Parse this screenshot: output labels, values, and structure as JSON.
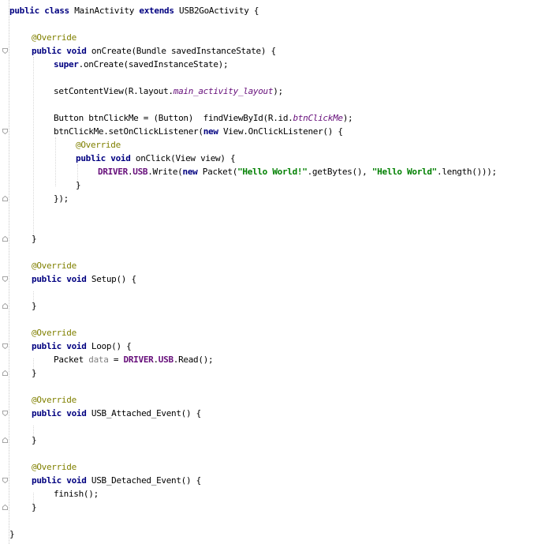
{
  "editor": {
    "lines": [
      {
        "indent": 0,
        "fold": "none",
        "tokens": [
          {
            "t": "public class ",
            "c": "kw"
          },
          {
            "t": "MainActivity ",
            "c": ""
          },
          {
            "t": "extends ",
            "c": "kw"
          },
          {
            "t": "USB2GoActivity {",
            "c": ""
          }
        ]
      },
      {
        "indent": 0,
        "fold": "none",
        "tokens": []
      },
      {
        "indent": 1,
        "fold": "none",
        "tokens": [
          {
            "t": "@Override",
            "c": "ann"
          }
        ]
      },
      {
        "indent": 1,
        "fold": "open",
        "tokens": [
          {
            "t": "public void ",
            "c": "kw"
          },
          {
            "t": "onCreate(Bundle savedInstanceState) {",
            "c": ""
          }
        ]
      },
      {
        "indent": 2,
        "fold": "none",
        "tokens": [
          {
            "t": "super",
            "c": "kw"
          },
          {
            "t": ".onCreate(savedInstanceState);",
            "c": ""
          }
        ]
      },
      {
        "indent": 0,
        "fold": "none",
        "tokens": []
      },
      {
        "indent": 2,
        "fold": "none",
        "tokens": [
          {
            "t": "setContentView(R.layout.",
            "c": ""
          },
          {
            "t": "main_activity_layout",
            "c": "ital"
          },
          {
            "t": ");",
            "c": ""
          }
        ]
      },
      {
        "indent": 0,
        "fold": "none",
        "tokens": []
      },
      {
        "indent": 2,
        "fold": "none",
        "tokens": [
          {
            "t": "Button btnClickMe = (Button)  findViewById(R.id.",
            "c": ""
          },
          {
            "t": "btnClickMe",
            "c": "ital"
          },
          {
            "t": ");",
            "c": ""
          }
        ]
      },
      {
        "indent": 2,
        "fold": "open",
        "tokens": [
          {
            "t": "btnClickMe.setOnClickListener(",
            "c": ""
          },
          {
            "t": "new ",
            "c": "kw"
          },
          {
            "t": "View.OnClickListener() {",
            "c": ""
          }
        ]
      },
      {
        "indent": 3,
        "fold": "none",
        "tokens": [
          {
            "t": "@Override",
            "c": "ann"
          }
        ]
      },
      {
        "indent": 3,
        "fold": "none",
        "tokens": [
          {
            "t": "public void ",
            "c": "kw"
          },
          {
            "t": "onClick(View view) {",
            "c": ""
          }
        ]
      },
      {
        "indent": 4,
        "fold": "none",
        "tokens": [
          {
            "t": "DRIVER",
            "c": "fld"
          },
          {
            "t": ".",
            "c": ""
          },
          {
            "t": "USB",
            "c": "fld"
          },
          {
            "t": ".Write(",
            "c": ""
          },
          {
            "t": "new ",
            "c": "kw"
          },
          {
            "t": "Packet(",
            "c": ""
          },
          {
            "t": "\"Hello World!\"",
            "c": "str"
          },
          {
            "t": ".getBytes(), ",
            "c": ""
          },
          {
            "t": "\"Hello World\"",
            "c": "str"
          },
          {
            "t": ".length()));",
            "c": ""
          }
        ]
      },
      {
        "indent": 3,
        "fold": "none",
        "tokens": [
          {
            "t": "}",
            "c": ""
          }
        ]
      },
      {
        "indent": 2,
        "fold": "close",
        "tokens": [
          {
            "t": "});",
            "c": ""
          }
        ]
      },
      {
        "indent": 0,
        "fold": "none",
        "tokens": []
      },
      {
        "indent": 0,
        "fold": "none",
        "tokens": []
      },
      {
        "indent": 1,
        "fold": "close",
        "tokens": [
          {
            "t": "}",
            "c": ""
          }
        ]
      },
      {
        "indent": 0,
        "fold": "none",
        "tokens": []
      },
      {
        "indent": 1,
        "fold": "none",
        "tokens": [
          {
            "t": "@Override",
            "c": "ann"
          }
        ]
      },
      {
        "indent": 1,
        "fold": "open",
        "tokens": [
          {
            "t": "public void ",
            "c": "kw"
          },
          {
            "t": "Setup() {",
            "c": ""
          }
        ]
      },
      {
        "indent": 0,
        "fold": "none",
        "tokens": []
      },
      {
        "indent": 1,
        "fold": "close",
        "tokens": [
          {
            "t": "}",
            "c": ""
          }
        ]
      },
      {
        "indent": 0,
        "fold": "none",
        "tokens": []
      },
      {
        "indent": 1,
        "fold": "none",
        "tokens": [
          {
            "t": "@Override",
            "c": "ann"
          }
        ]
      },
      {
        "indent": 1,
        "fold": "open",
        "tokens": [
          {
            "t": "public void ",
            "c": "kw"
          },
          {
            "t": "Loop() {",
            "c": ""
          }
        ]
      },
      {
        "indent": 2,
        "fold": "none",
        "tokens": [
          {
            "t": "Packet ",
            "c": ""
          },
          {
            "t": "data",
            "c": "unused"
          },
          {
            "t": " = ",
            "c": ""
          },
          {
            "t": "DRIVER",
            "c": "fld"
          },
          {
            "t": ".",
            "c": ""
          },
          {
            "t": "USB",
            "c": "fld"
          },
          {
            "t": ".Read();",
            "c": ""
          }
        ]
      },
      {
        "indent": 1,
        "fold": "close",
        "tokens": [
          {
            "t": "}",
            "c": ""
          }
        ]
      },
      {
        "indent": 0,
        "fold": "none",
        "tokens": []
      },
      {
        "indent": 1,
        "fold": "none",
        "tokens": [
          {
            "t": "@Override",
            "c": "ann"
          }
        ]
      },
      {
        "indent": 1,
        "fold": "open",
        "tokens": [
          {
            "t": "public void ",
            "c": "kw"
          },
          {
            "t": "USB_Attached_Event() {",
            "c": ""
          }
        ]
      },
      {
        "indent": 0,
        "fold": "none",
        "tokens": []
      },
      {
        "indent": 1,
        "fold": "close",
        "tokens": [
          {
            "t": "}",
            "c": ""
          }
        ]
      },
      {
        "indent": 0,
        "fold": "none",
        "tokens": []
      },
      {
        "indent": 1,
        "fold": "none",
        "tokens": [
          {
            "t": "@Override",
            "c": "ann"
          }
        ]
      },
      {
        "indent": 1,
        "fold": "open",
        "tokens": [
          {
            "t": "public void ",
            "c": "kw"
          },
          {
            "t": "USB_Detached_Event() {",
            "c": ""
          }
        ]
      },
      {
        "indent": 2,
        "fold": "none",
        "tokens": [
          {
            "t": "finish();",
            "c": ""
          }
        ]
      },
      {
        "indent": 1,
        "fold": "close",
        "tokens": [
          {
            "t": "}",
            "c": ""
          }
        ]
      },
      {
        "indent": 0,
        "fold": "none",
        "tokens": []
      },
      {
        "indent": 0,
        "fold": "none",
        "tokens": [
          {
            "t": "}",
            "c": ""
          }
        ]
      }
    ]
  }
}
